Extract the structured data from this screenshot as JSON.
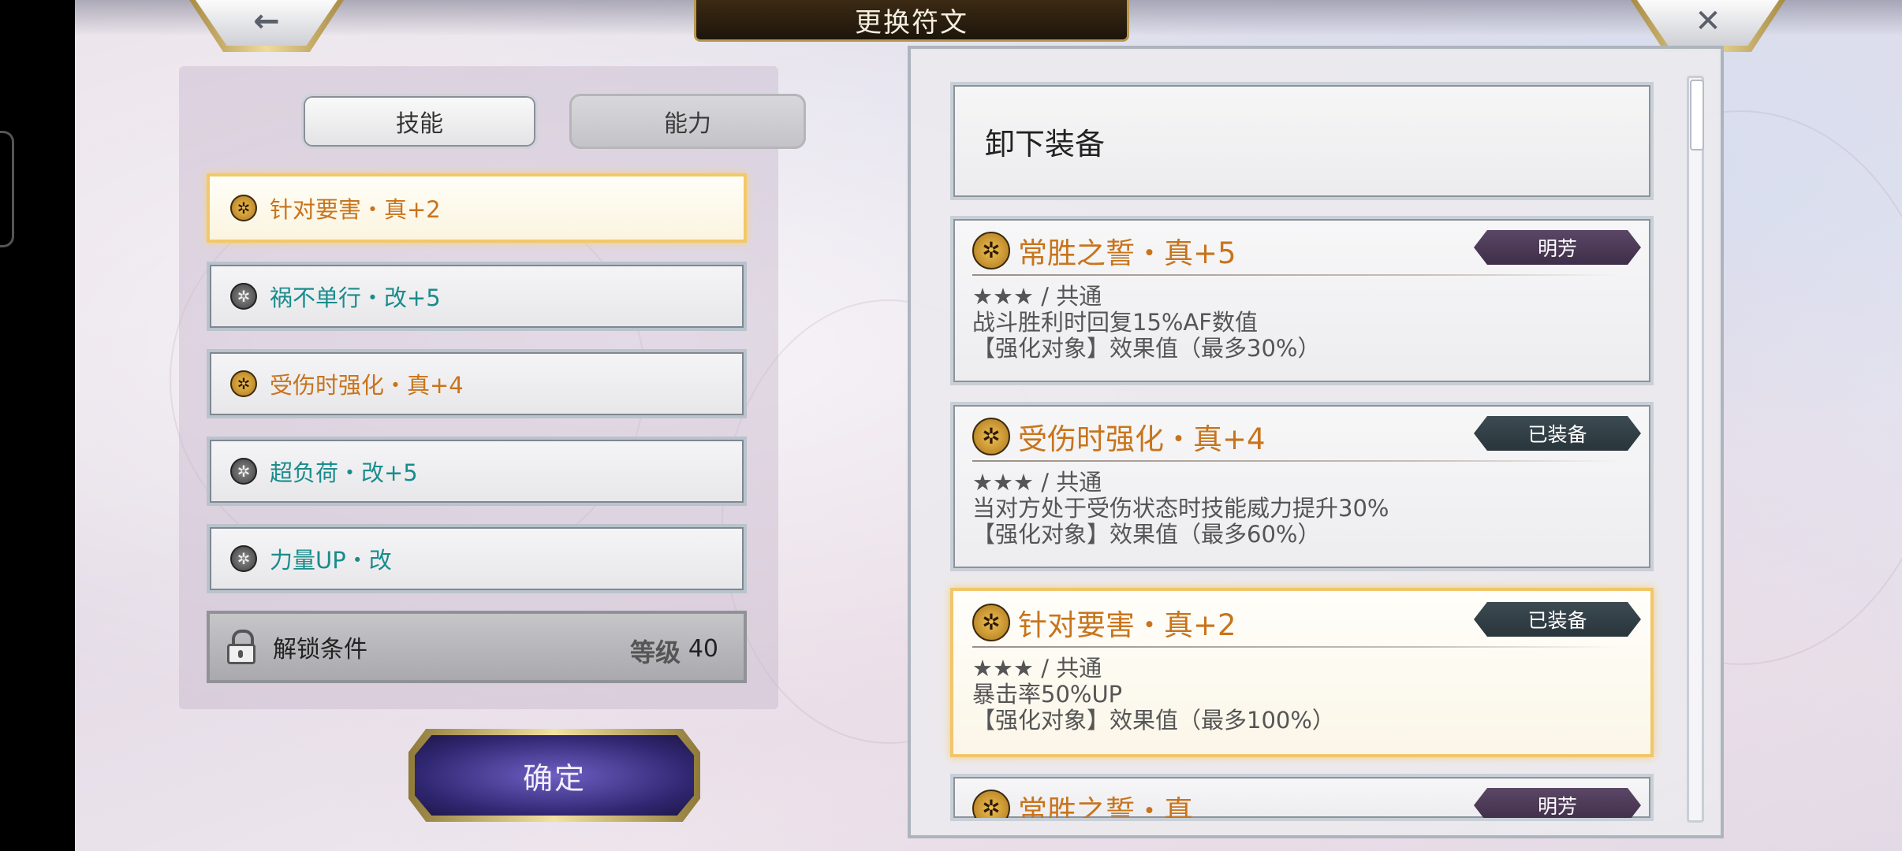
{
  "header": {
    "title": "更换符文",
    "back_icon": "←",
    "close_icon": "✕"
  },
  "tabs": [
    {
      "label": "技能",
      "active": true
    },
    {
      "label": "能力",
      "active": false
    }
  ],
  "skill_slots": [
    {
      "label": "针对要害・真+2",
      "icon": "gold",
      "selected": true
    },
    {
      "label": "祸不单行・改+5",
      "icon": "gray",
      "selected": false
    },
    {
      "label": "受伤时强化・真+4",
      "icon": "gold",
      "selected": false
    },
    {
      "label": "超负荷・改+5",
      "icon": "gray",
      "selected": false
    },
    {
      "label": "力量UP・改",
      "icon": "gray",
      "selected": false
    }
  ],
  "locked_slot": {
    "label": "解锁条件",
    "level_label": "等级",
    "level_value": "40"
  },
  "confirm_label": "确定",
  "unequip_label": "卸下装备",
  "rune_cards": [
    {
      "title": "常胜之誓・真+5",
      "badge": "明芳",
      "badge_color": "#4b3856",
      "rarity": "★★★ / 共通",
      "desc": "战斗胜利时回复15%AF数值",
      "note": "【强化对象】效果值（最多30%）",
      "selected": false
    },
    {
      "title": "受伤时强化・真+4",
      "badge": "已装备",
      "badge_color": "#323f46",
      "rarity": "★★★ / 共通",
      "desc": "当对方处于受伤状态时技能威力提升30%",
      "note": "【强化对象】效果值（最多60%）",
      "selected": false
    },
    {
      "title": "针对要害・真+2",
      "badge": "已装备",
      "badge_color": "#323f46",
      "rarity": "★★★ / 共通",
      "desc": "暴击率50%UP",
      "note": "【强化对象】效果值（最多100%）",
      "selected": true
    },
    {
      "title": "常胜之誓・真",
      "badge": "明芳",
      "badge_color": "#4b3856",
      "rarity": "",
      "desc": "",
      "note": "",
      "selected": false
    }
  ],
  "colors": {
    "accent_gold": "#f1c66a",
    "title_orange": "#c8741c",
    "slot_teal": "#1a8c8c"
  }
}
